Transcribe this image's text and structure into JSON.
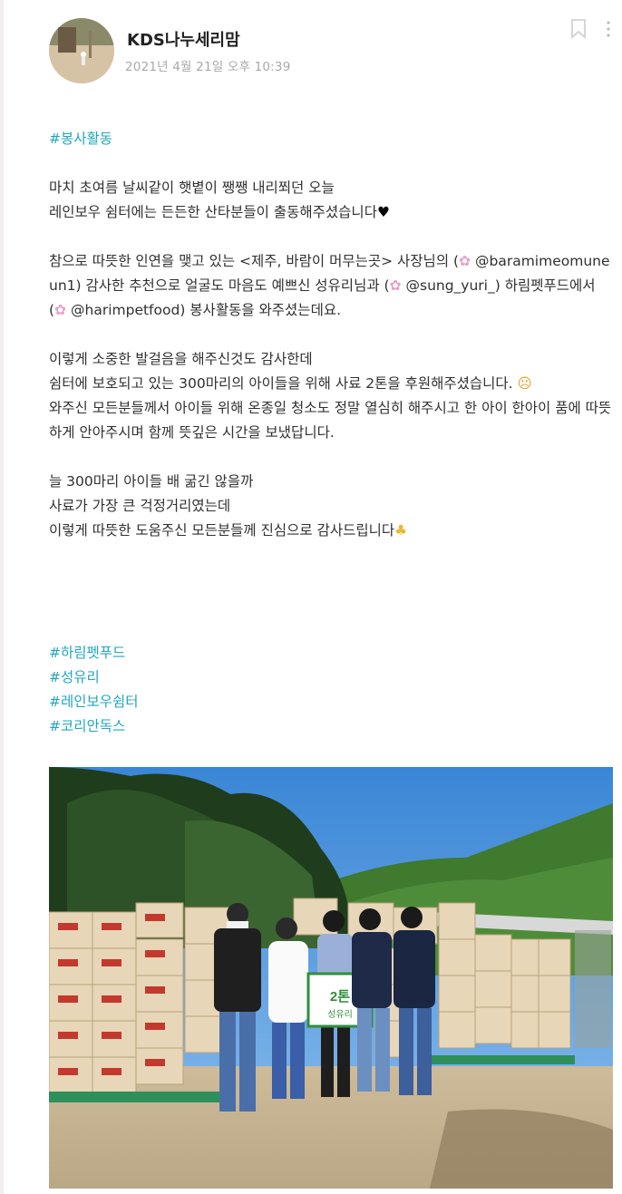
{
  "post": {
    "author": "KDS나누세리맘",
    "date": "2021년 4월 21일 오후 10:39",
    "top_hashtag": "#봉사활동",
    "paragraphs": {
      "p1_line1": "마치 초여름 날씨같이 햇볕이 쨍쨍 내리쬐던 오늘",
      "p1_line2": "레인보우 쉼터에는 든든한 산타분들이 출동해주셨습니다",
      "p2_part1": "참으로 따뜻한 인연을 맺고 있는 <제주, 바람이 머무는곳> 사장님의 (",
      "p2_mention1": "@baramimeomuneun1",
      "p2_part2": ") 감사한 추천으로 얼굴도 마음도 예쁘신 성유리님과 (",
      "p2_mention2": "@sung_yuri_",
      "p2_part3": ") 하림펫푸드에서 (",
      "p2_mention3": "@harimpetfood",
      "p2_part4": ") 봉사활동을 와주셨는데요.",
      "p3_line1": "이렇게 소중한 발걸음을 해주신것도 감사한데",
      "p3_line2": "쉼터에 보호되고 있는 300마리의 아이들을 위해 사료 2톤을 후원해주셨습니다.",
      "p3_line3": "와주신 모든분들께서 아이들 위해 온종일 청소도 정말 열심히 해주시고 한 아이 한아이 품에 따뜻하게 안아주시며 함께 뜻깊은 시간을 보냈답니다.",
      "p4_line1": "늘 300마리 아이들 배 굶긴 않을까",
      "p4_line2": "사료가 가장 큰 걱정거리였는데",
      "p4_line3": "이렇게 따뜻한 도움주신 모든분들께 진심으로 감사드립니다"
    },
    "hashtags": [
      "#하림펫푸드",
      "#성유리",
      "#레인보우쉼터",
      "#코리안독스"
    ],
    "emoji": {
      "heart": "♥",
      "flower": "✿",
      "sad": "☹",
      "pray": "♣"
    },
    "photo_sign": {
      "top": "2톤",
      "name": "성유리"
    }
  },
  "colors": {
    "hashtag": "#1fa7bf",
    "text": "#303030",
    "date": "#a9a9a9"
  }
}
